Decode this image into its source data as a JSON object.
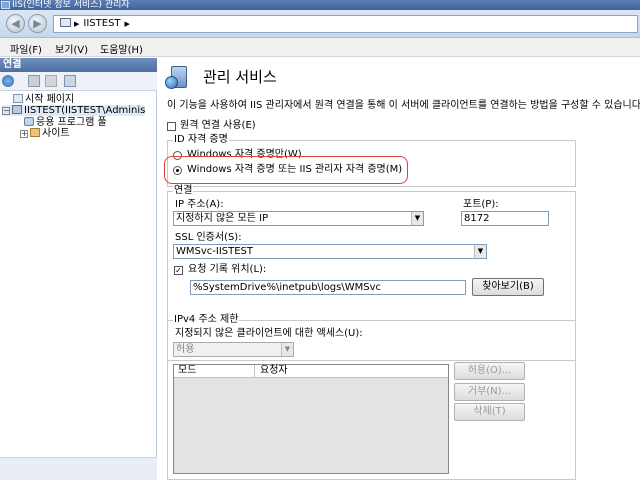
{
  "window": {
    "title": "IIS(인터넷 정보 서비스) 관리자"
  },
  "address": {
    "nav_back": "◀",
    "nav_forward": "▶",
    "crumb": "IISTEST",
    "crumb_sep": "▶"
  },
  "menu": {
    "file": "파일(F)",
    "view": "보기(V)",
    "help": "도움말(H)"
  },
  "connections": {
    "header": "연결",
    "tree": [
      {
        "label": "시작 페이지"
      },
      {
        "label": "IISTEST(IISTEST\\Adminis"
      },
      {
        "label": "응용 프로그램 풀"
      },
      {
        "label": "사이트"
      }
    ]
  },
  "page": {
    "title": "관리 서비스",
    "description": "이 기능을 사용하여 IIS 관리자에서 원격 연결을 통해 이 서버에 클라이언트를 연결하는 방법을 구성할 수 있습니다.",
    "enable_remote": {
      "label": "원격 연결 사용(E)",
      "checked": false
    }
  },
  "identity": {
    "title": "ID 자격 증명",
    "options": [
      {
        "label": "Windows 자격 증명만(W)",
        "selected": false
      },
      {
        "label": "Windows 자격 증명 또는 IIS 관리자 자격 증명(M)",
        "selected": true
      }
    ]
  },
  "connection": {
    "title": "연결",
    "ip_label": "IP 주소(A):",
    "ip_value": "지정하지 않은 모든 IP",
    "port_label": "포트(P):",
    "port_value": "8172",
    "ssl_label": "SSL 인증서(S):",
    "ssl_value": "WMSvc-IISTEST",
    "log_label": "요청 기록 위치(L):",
    "log_checked": true,
    "log_path": "%SystemDrive%\\inetpub\\logs\\WMSvc",
    "browse_button": "찾아보기(B)"
  },
  "ipv4": {
    "title": "IPv4 주소 제한",
    "access_label": "지정되지 않은 클라이언트에 대한 액세스(U):",
    "access_value": "허용",
    "columns": [
      "모드",
      "요청자"
    ],
    "allow_button": "허용(O)...",
    "deny_button": "거부(N)...",
    "delete_button": "삭제(T)"
  },
  "colors": {
    "highlight": "#e04040",
    "titlebar": "#4d6ea3"
  }
}
